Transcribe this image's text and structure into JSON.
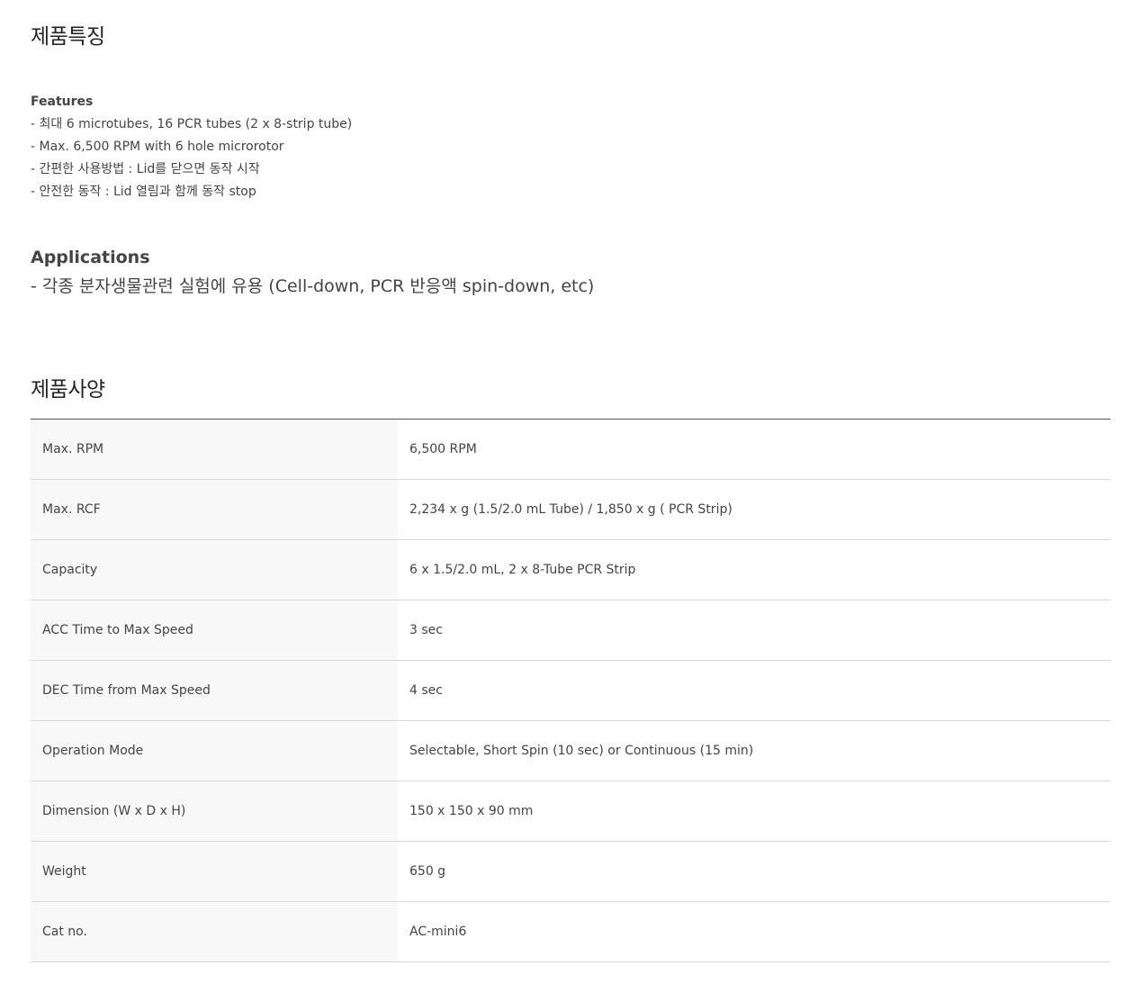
{
  "features_section": {
    "title": "제품특징",
    "heading": "Features",
    "items": [
      "- 최대 6 microtubes, 16 PCR tubes (2 x 8-strip tube)",
      "- Max. 6,500 RPM with 6 hole microrotor",
      "- 간편한 사용방법 : Lid를 닫으면 동작 시작",
      "- 안전한 동작 : Lid 열림과 함께 동작 stop"
    ]
  },
  "applications": {
    "heading": "Applications",
    "text": "- 각종 분자생물관련 실험에 유용 (Cell-down, PCR 반응액 spin-down, etc)"
  },
  "specs_section": {
    "title": "제품사양",
    "rows": [
      {
        "key": "Max. RPM",
        "value": "6,500 RPM"
      },
      {
        "key": "Max. RCF",
        "value": "2,234 x g (1.5/2.0 mL Tube) / 1,850 x g ( PCR Strip)"
      },
      {
        "key": "Capacity",
        "value": "6 x 1.5/2.0 mL, 2 x 8-Tube PCR Strip"
      },
      {
        "key": "ACC Time to Max Speed",
        "value": "3 sec"
      },
      {
        "key": "DEC Time from Max Speed",
        "value": "4 sec"
      },
      {
        "key": "Operation Mode",
        "value": "Selectable, Short Spin (10 sec) or Continuous (15 min)"
      },
      {
        "key": "Dimension (W x D x H)",
        "value": "150 x 150 x 90 mm"
      },
      {
        "key": "Weight",
        "value": "650 g"
      },
      {
        "key": "Cat no.",
        "value": "AC-mini6"
      }
    ]
  }
}
